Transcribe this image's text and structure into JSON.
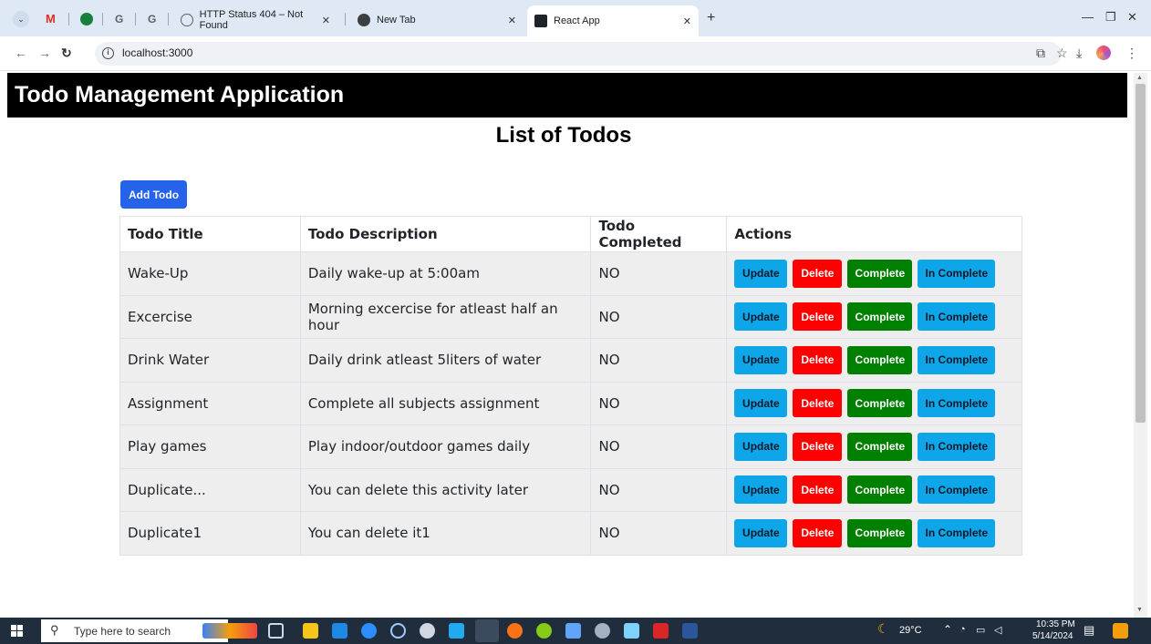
{
  "browser": {
    "tabs": [
      {
        "label": "HTTP Status 404 – Not Found"
      },
      {
        "label": "New Tab"
      },
      {
        "label": "React App",
        "active": true
      }
    ],
    "url": "localhost:3000"
  },
  "page": {
    "app_title": "Todo Management Application",
    "list_title": "List of Todos",
    "add_button": "Add Todo"
  },
  "table": {
    "headers": [
      "Todo Title",
      "Todo Description",
      "Todo Completed",
      "Actions"
    ],
    "rows": [
      {
        "title": "Wake-Up",
        "description": "Daily wake-up at 5:00am",
        "completed": "NO"
      },
      {
        "title": "Excercise",
        "description": "Morning excercise for atleast half an hour",
        "completed": "NO"
      },
      {
        "title": "Drink Water",
        "description": "Daily drink atleast 5liters of water",
        "completed": "NO"
      },
      {
        "title": "Assignment",
        "description": "Complete all subjects assignment",
        "completed": "NO"
      },
      {
        "title": "Play games",
        "description": "Play indoor/outdoor games daily",
        "completed": "NO"
      },
      {
        "title": "Duplicate...",
        "description": "You can delete this activity later",
        "completed": "NO"
      },
      {
        "title": "Duplicate1",
        "description": "You can delete it1",
        "completed": "NO"
      }
    ],
    "actions": {
      "update": "Update",
      "delete": "Delete",
      "complete": "Complete",
      "incomplete": "In Complete"
    }
  },
  "taskbar": {
    "search_placeholder": "Type here to search",
    "weather": "29°C",
    "time": "10:35 PM",
    "date": "5/14/2024"
  },
  "colors": {
    "header_bg": "#000000",
    "add_button": "#2563eb",
    "update": "#0ea5e9",
    "delete": "#ff0000",
    "complete": "#008000",
    "incomplete": "#0ea5e9"
  }
}
